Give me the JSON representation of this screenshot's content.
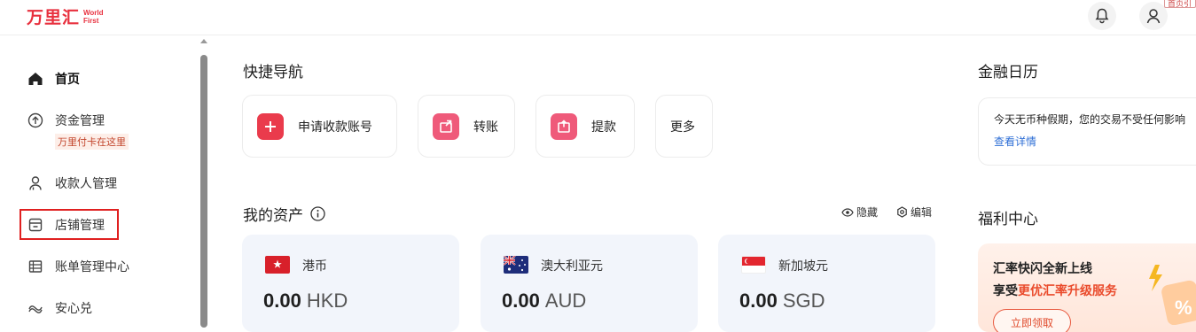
{
  "header": {
    "logo_cn": "万里汇",
    "logo_en_line1": "World",
    "logo_en_line2": "First",
    "corner_tag": "首页引"
  },
  "sidebar": {
    "items": [
      {
        "label": "首页",
        "icon": "home-icon",
        "active": true
      },
      {
        "label": "资金管理",
        "icon": "fund-icon",
        "sub": "万里付卡在这里"
      },
      {
        "label": "收款人管理",
        "icon": "payee-icon"
      },
      {
        "label": "店铺管理",
        "icon": "store-icon"
      },
      {
        "label": "账单管理中心",
        "icon": "bill-icon"
      },
      {
        "label": "安心兑",
        "icon": "exchange-icon"
      }
    ]
  },
  "quick_nav": {
    "title": "快捷导航",
    "items": [
      {
        "label": "申请收款账号",
        "icon": "plus-icon"
      },
      {
        "label": "转账",
        "icon": "transfer-icon"
      },
      {
        "label": "提款",
        "icon": "withdraw-icon"
      },
      {
        "label": "更多"
      }
    ]
  },
  "assets": {
    "title": "我的资产",
    "hide_label": "隐藏",
    "edit_label": "编辑",
    "cards": [
      {
        "currency_name": "港币",
        "amount": "0.00",
        "code": "HKD",
        "flag": "hk-flag"
      },
      {
        "currency_name": "澳大利亚元",
        "amount": "0.00",
        "code": "AUD",
        "flag": "au-flag"
      },
      {
        "currency_name": "新加坡元",
        "amount": "0.00",
        "code": "SGD",
        "flag": "sg-flag"
      }
    ]
  },
  "calendar": {
    "title": "金融日历",
    "text": "今天无币种假期，您的交易不受任何影响",
    "link": "查看详情"
  },
  "welfare": {
    "title": "福利中心",
    "line1": "汇率快闪全新上线",
    "line2_prefix": "享受",
    "line2_highlight": "更优汇率升级服务",
    "button": "立即领取"
  },
  "colors": {
    "brand": "#e8303e",
    "link": "#2f6fd6",
    "highlight_border": "#e02020"
  }
}
